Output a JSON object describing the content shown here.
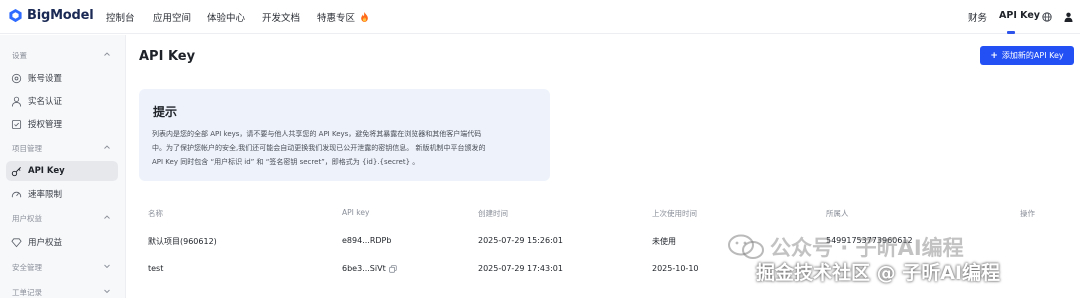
{
  "header": {
    "logo_text": "BigModel",
    "nav": [
      "控制台",
      "应用空间",
      "体验中心",
      "开发文档",
      "特惠专区"
    ],
    "promo_icon": "fire-icon",
    "right": {
      "finance": "财务",
      "apikey": "API Key"
    },
    "accent": "#2350f5"
  },
  "sidebar": {
    "sections": [
      {
        "title": "设置",
        "items": [
          {
            "label": "账号设置",
            "icon": "gear-icon"
          },
          {
            "label": "实名认证",
            "icon": "user-icon"
          },
          {
            "label": "授权管理",
            "icon": "authorize-icon"
          }
        ]
      },
      {
        "title": "项目管理",
        "items": [
          {
            "label": "API Key",
            "icon": "key-icon",
            "active": true
          },
          {
            "label": "速率限制",
            "icon": "gauge-icon"
          }
        ]
      },
      {
        "title": "用户权益",
        "items": [
          {
            "label": "用户权益",
            "icon": "diamond-icon"
          }
        ]
      },
      {
        "title": "安全管理",
        "items": []
      },
      {
        "title": "工单记录",
        "items": []
      }
    ]
  },
  "main": {
    "title": "API Key",
    "add_button": "添加新的API Key",
    "tip": {
      "title": "提示",
      "lines": [
        "列表内是您的全部 API keys，请不要与他人共享您的 API Keys，避免将其暴露在浏览器和其他客户端代码",
        "中。为了保护您帐户的安全,我们还可能会自动更换我们发现已公开泄露的密钥信息。 新版机制中平台颁发的",
        "API Key 同时包含 “用户标识 id” 和 “签名密钥 secret”，即格式为 {id}.{secret} 。"
      ]
    },
    "table": {
      "headers": [
        "名称",
        "API key",
        "创建时间",
        "上次使用时间",
        "所属人",
        "操作"
      ],
      "rows": [
        {
          "name": "默认项目(960612)",
          "key": "e894...RDPb",
          "created": "2025-07-29 15:26:01",
          "last_used": "未使用",
          "owner": "54991753773960612"
        },
        {
          "name": "test",
          "key": "6be3...SiVt",
          "created": "2025-07-29 17:43:01",
          "last_used": "2025-10-10",
          "owner": ""
        }
      ]
    }
  },
  "watermark": {
    "line1": "公众号 · 子昕AI编程",
    "line2": "掘金技术社区 @ 子昕AI编程"
  }
}
